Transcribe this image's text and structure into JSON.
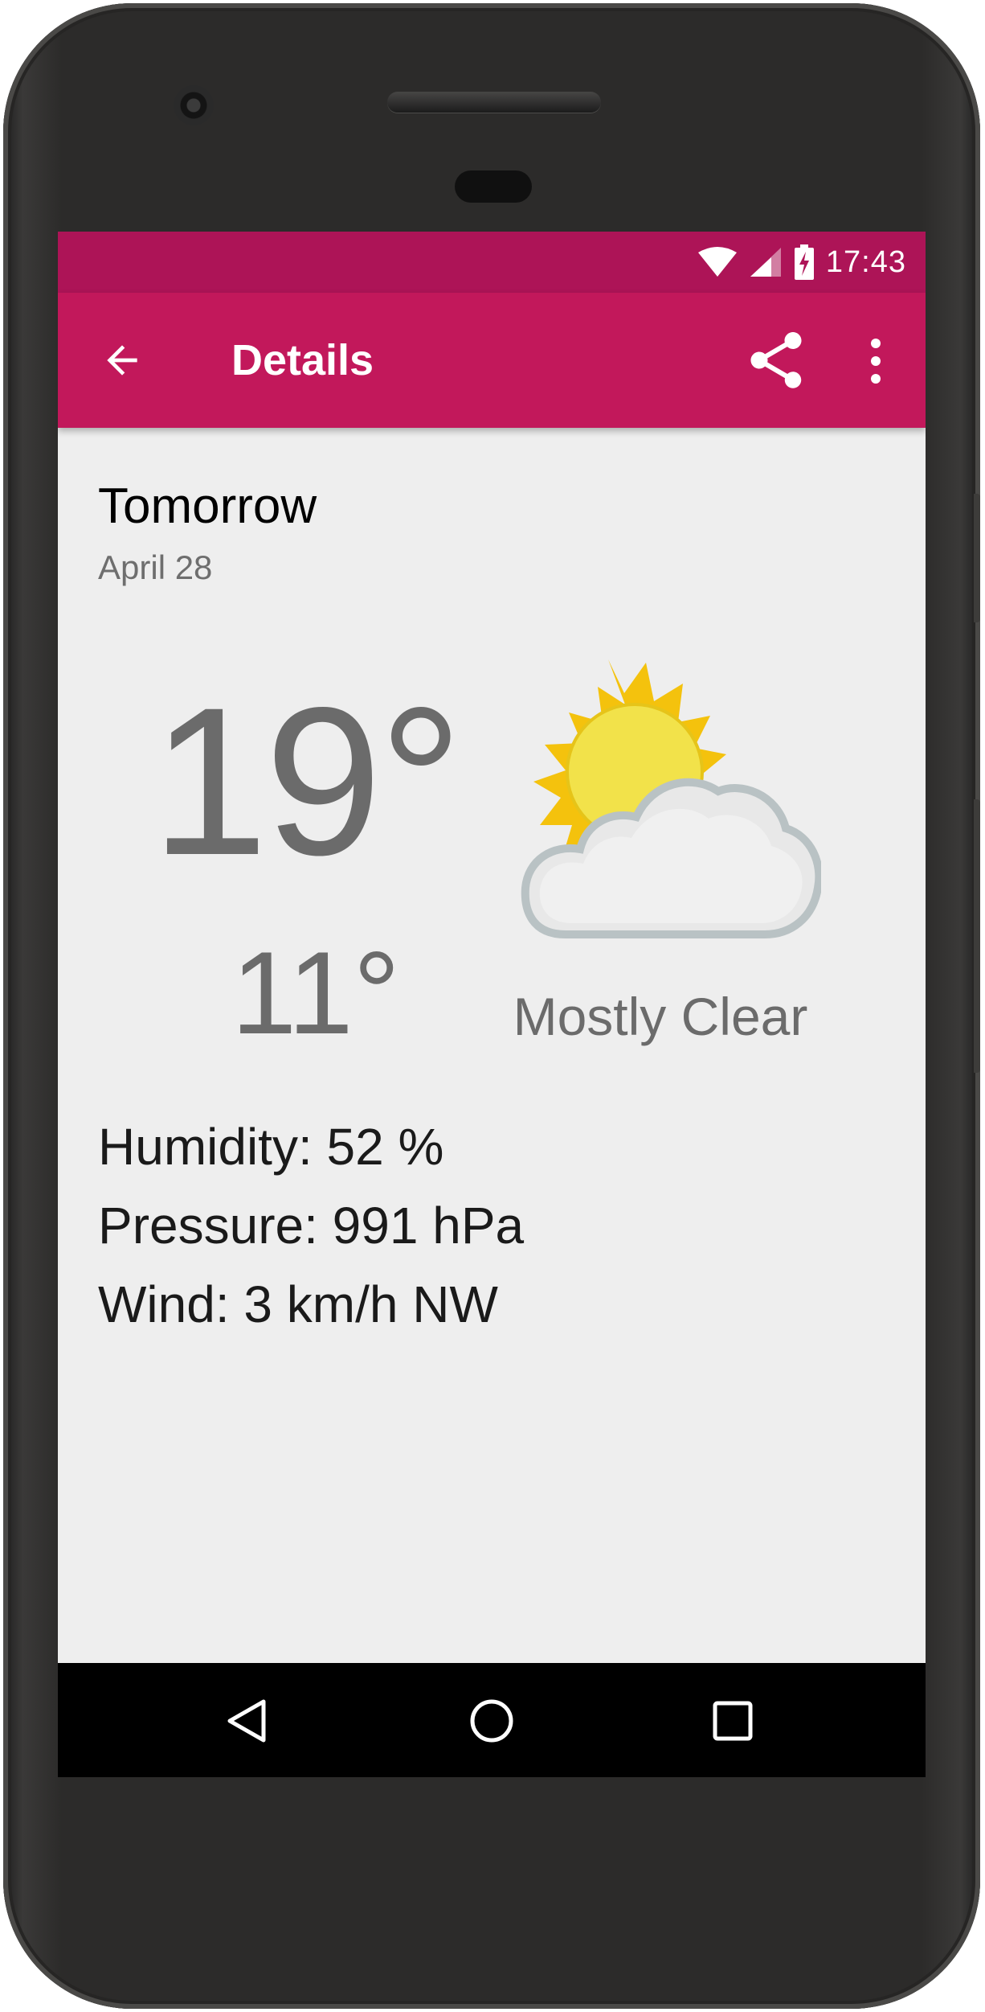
{
  "status_bar": {
    "time": "17:43",
    "icons": [
      "wifi-icon",
      "cellular-signal-icon",
      "battery-charging-icon"
    ]
  },
  "toolbar": {
    "title": "Details",
    "back_icon": "arrow-back-icon",
    "share_icon": "share-icon",
    "overflow_icon": "more-vert-icon",
    "background_color": "#c2185b",
    "status_bar_color": "#ad1457"
  },
  "forecast": {
    "day": "Tomorrow",
    "date": "April 28",
    "high": "19°",
    "low": "11°",
    "condition": "Mostly Clear",
    "condition_icon": "sun-behind-cloud-icon",
    "details": [
      "Humidity: 52 %",
      "Pressure: 991 hPa",
      "Wind: 3 km/h NW"
    ]
  },
  "navigation_bar": {
    "buttons": [
      "back-triangle-icon",
      "home-circle-icon",
      "recents-square-icon"
    ]
  }
}
